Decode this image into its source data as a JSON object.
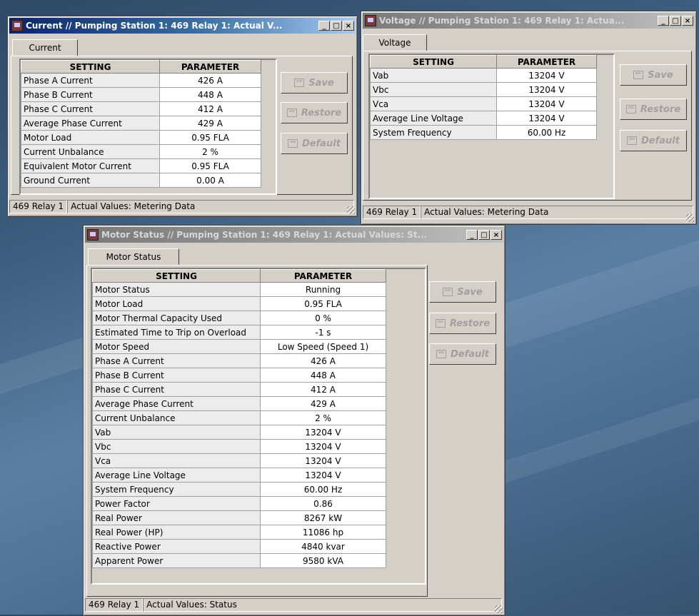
{
  "windows": {
    "current": {
      "title": "Current // Pumping Station 1: 469 Relay 1: Actual V...",
      "tab": "Current",
      "headers": [
        "SETTING",
        "PARAMETER"
      ],
      "rows": [
        [
          "Phase A Current",
          "426 A"
        ],
        [
          "Phase B Current",
          "448 A"
        ],
        [
          "Phase C Current",
          "412 A"
        ],
        [
          "Average Phase Current",
          "429 A"
        ],
        [
          "Motor Load",
          "0.95 FLA"
        ],
        [
          "Current Unbalance",
          "2 %"
        ],
        [
          "Equivalent Motor Current",
          "0.95 FLA"
        ],
        [
          "Ground Current",
          "0.00 A"
        ]
      ],
      "buttons": {
        "save": "Save",
        "restore": "Restore",
        "default": "Default"
      },
      "status": [
        "469 Relay 1",
        "Actual Values: Metering Data"
      ]
    },
    "voltage": {
      "title": "Voltage // Pumping Station 1: 469 Relay 1: Actua...",
      "tab": "Voltage",
      "headers": [
        "SETTING",
        "PARAMETER"
      ],
      "rows": [
        [
          "Vab",
          "13204 V"
        ],
        [
          "Vbc",
          "13204 V"
        ],
        [
          "Vca",
          "13204 V"
        ],
        [
          "Average Line Voltage",
          "13204 V"
        ],
        [
          "System Frequency",
          "60.00 Hz"
        ]
      ],
      "buttons": {
        "save": "Save",
        "restore": "Restore",
        "default": "Default"
      },
      "status": [
        "469 Relay 1",
        "Actual Values: Metering Data"
      ]
    },
    "motor": {
      "title": "Motor Status // Pumping Station 1: 469 Relay 1: Actual Values: St...",
      "tab": "Motor Status",
      "headers": [
        "SETTING",
        "PARAMETER"
      ],
      "rows": [
        [
          "Motor Status",
          "Running"
        ],
        [
          "Motor Load",
          "0.95 FLA"
        ],
        [
          "Motor Thermal Capacity Used",
          "0 %"
        ],
        [
          "Estimated Time to Trip on Overload",
          "-1 s"
        ],
        [
          "Motor Speed",
          "Low Speed (Speed 1)"
        ],
        [
          "Phase A Current",
          "426 A"
        ],
        [
          "Phase B Current",
          "448 A"
        ],
        [
          "Phase C Current",
          "412 A"
        ],
        [
          "Average Phase Current",
          "429 A"
        ],
        [
          "Current Unbalance",
          "2 %"
        ],
        [
          "Vab",
          "13204 V"
        ],
        [
          "Vbc",
          "13204 V"
        ],
        [
          "Vca",
          "13204 V"
        ],
        [
          "Average Line Voltage",
          "13204 V"
        ],
        [
          "System Frequency",
          "60.00 Hz"
        ],
        [
          "Power Factor",
          "0.86"
        ],
        [
          "Real Power",
          "8267 kW"
        ],
        [
          "Real Power (HP)",
          "11086 hp"
        ],
        [
          "Reactive Power",
          "4840 kvar"
        ],
        [
          "Apparent Power",
          "9580 kVA"
        ]
      ],
      "buttons": {
        "save": "Save",
        "restore": "Restore",
        "default": "Default"
      },
      "status": [
        "469 Relay 1",
        "Actual Values: Status"
      ]
    }
  },
  "titlebar_buttons": {
    "minimize": "_",
    "maximize": "□",
    "close": "×"
  }
}
